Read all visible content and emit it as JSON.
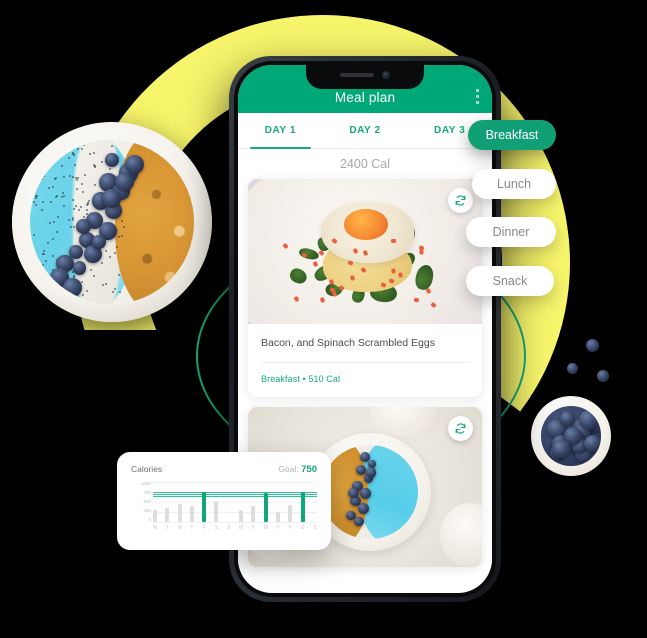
{
  "app": {
    "title": "Meal plan",
    "menu_icon": "kebab-menu-icon"
  },
  "tabs": [
    {
      "label": "DAY 1",
      "active": true
    },
    {
      "label": "DAY 2",
      "active": false
    },
    {
      "label": "DAY 3",
      "active": false
    }
  ],
  "daily_total": "2400 Cal",
  "meal_chips": [
    {
      "label": "Breakfast",
      "selected": true
    },
    {
      "label": "Lunch",
      "selected": false
    },
    {
      "label": "Dinner",
      "selected": false
    },
    {
      "label": "Snack",
      "selected": false
    }
  ],
  "cards": [
    {
      "title": "Bacon, and Spinach Scrambled Eggs",
      "meta": "Breakfast • 510 Cal",
      "refresh_icon": "refresh-icon"
    },
    {
      "title": "",
      "meta": "",
      "refresh_icon": "refresh-icon"
    }
  ],
  "calories_widget": {
    "title": "Calories",
    "goal_label": "Goal:",
    "goal_value": "750"
  },
  "chart_data": {
    "type": "bar",
    "title": "Calories",
    "categories": [
      "M",
      "T",
      "W",
      "T",
      "F",
      "S",
      "S",
      "M",
      "T",
      "W",
      "T",
      "F",
      "S",
      "S"
    ],
    "values": [
      290,
      360,
      450,
      400,
      750,
      520,
      0,
      300,
      400,
      720,
      250,
      430,
      740,
      0
    ],
    "highlight_index": [
      4,
      9,
      12
    ],
    "goal": 750,
    "ylabel": "",
    "xlabel": "",
    "ylim": [
      0,
      1000
    ],
    "yticks": [
      "1000",
      "750",
      "500",
      "250",
      "0"
    ],
    "grid": true,
    "legend": false,
    "colors": {
      "bar": "#DEDEDE",
      "bar_highlight": "#10A67C",
      "goal_line": "#2EC49A"
    }
  },
  "colors": {
    "brand_green": "#00A877",
    "accent_green": "#16A97C",
    "chip_green": "#11A075",
    "backdrop_yellow": "#F7F56B",
    "background": "#000000"
  }
}
